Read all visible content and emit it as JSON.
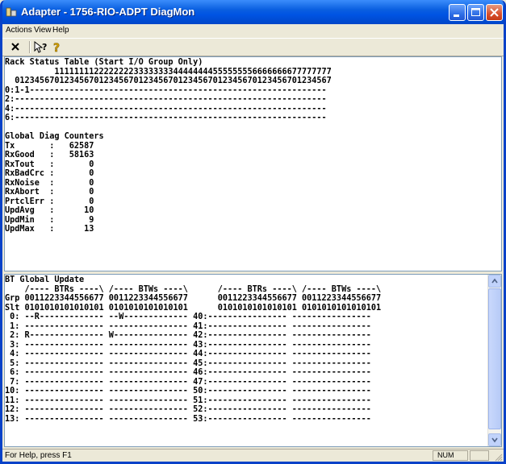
{
  "window": {
    "title": "Adapter - 1756-RIO-ADPT DiagMon"
  },
  "menu": {
    "items": [
      "Actions",
      "View",
      "Help"
    ]
  },
  "toolbar": {
    "buttons": [
      "close-x-icon",
      "context-help-icon",
      "about-help-icon"
    ]
  },
  "rack_status": {
    "title": "Rack Status Table (Start I/O Group Only)",
    "header1": "          11111111222222223333333344444444555555556666666677777777",
    "header2": "  0123456701234567012345670123456701234567012345670123456701234567",
    "rows": [
      "0:1-1------------------------------------------------------------",
      "2:---------------------------------------------------------------",
      "4:---------------------------------------------------------------",
      "6:---------------------------------------------------------------"
    ]
  },
  "counters": {
    "title": "Global Diag Counters",
    "items": [
      {
        "name": "Tx",
        "value": "62587"
      },
      {
        "name": "RxGood",
        "value": "58163"
      },
      {
        "name": "RxTout",
        "value": "0"
      },
      {
        "name": "RxBadCrc",
        "value": "0"
      },
      {
        "name": "RxNoise",
        "value": "0"
      },
      {
        "name": "RxAbort",
        "value": "0"
      },
      {
        "name": "PrtclErr",
        "value": "0"
      },
      {
        "name": "UpdAvg",
        "value": "10"
      },
      {
        "name": "UpdMin",
        "value": "9"
      },
      {
        "name": "UpdMax",
        "value": "13"
      }
    ]
  },
  "bt_update": {
    "lines": [
      "BT Global Update",
      "    /---- BTRs ----\\ /---- BTWs ----\\      /---- BTRs ----\\ /---- BTWs ----\\",
      "Grp 0011223344556677 0011223344556677      0011223344556677 0011223344556677",
      "Slt 0101010101010101 0101010101010101      0101010101010101 0101010101010101",
      " 0: --R------------- --W------------- 40:---------------- ----------------",
      " 1: ---------------- ---------------- 41:---------------- ----------------",
      " 2: R--------------- W--------------- 42:---------------- ----------------",
      " 3: ---------------- ---------------- 43:---------------- ----------------",
      " 4: ---------------- ---------------- 44:---------------- ----------------",
      " 5: ---------------- ---------------- 45:---------------- ----------------",
      " 6: ---------------- ---------------- 46:---------------- ----------------",
      " 7: ---------------- ---------------- 47:---------------- ----------------",
      "10: ---------------- ---------------- 50:---------------- ----------------",
      "11: ---------------- ---------------- 51:---------------- ----------------",
      "12: ---------------- ---------------- 52:---------------- ----------------",
      "13: ---------------- ---------------- 53:---------------- ----------------"
    ]
  },
  "status": {
    "help": "For Help, press F1",
    "num": "NUM"
  }
}
